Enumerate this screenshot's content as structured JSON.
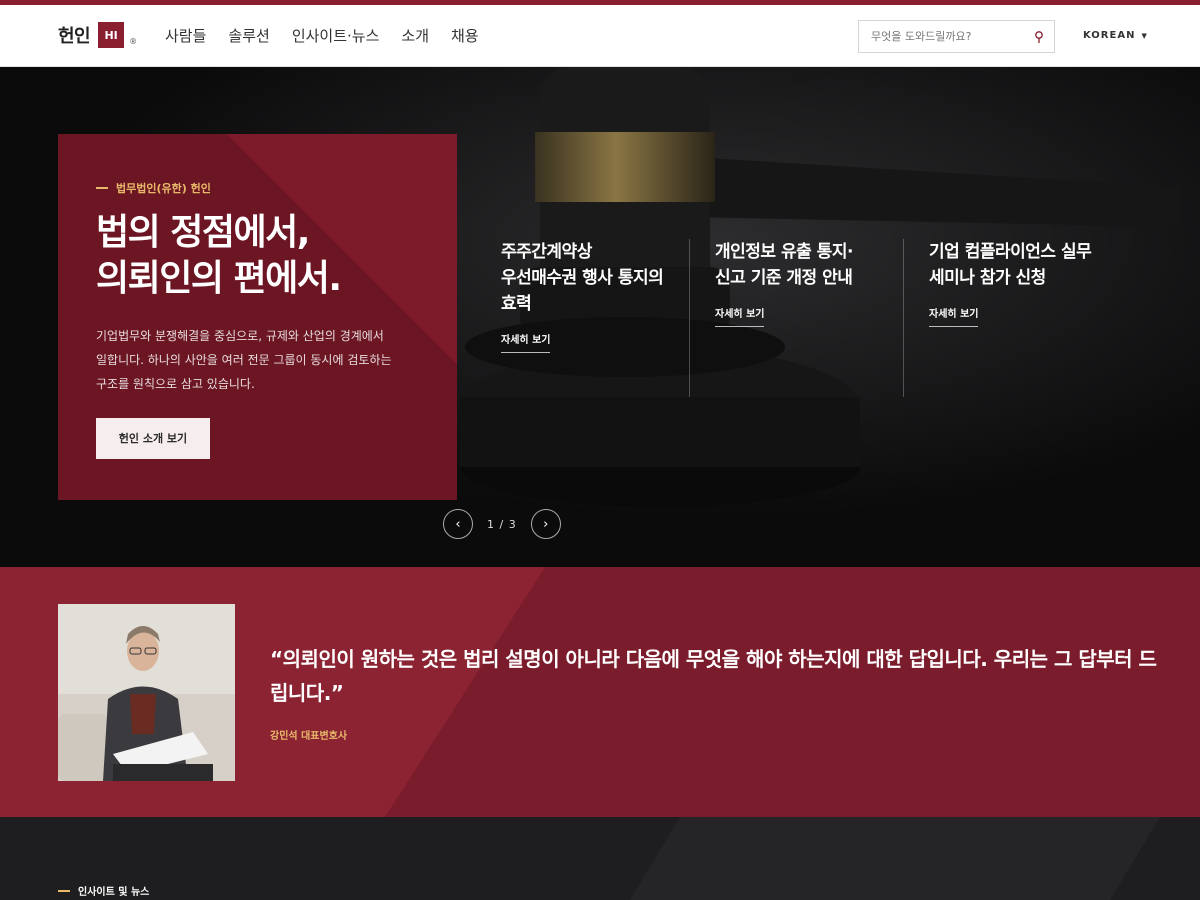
{
  "header": {
    "logo_text": "헌인",
    "logo_badge": "HI",
    "logo_reg": "®",
    "nav": [
      "사람들",
      "솔루션",
      "인사이트·뉴스",
      "소개",
      "채용"
    ],
    "search_placeholder": "무엇을 도와드릴까요?",
    "language": "KOREAN"
  },
  "hero": {
    "eyebrow": "법무법인(유한) 헌인",
    "title": "법의 정점에서,\n의뢰인의 편에서.",
    "description": "기업법무와 분쟁해결을 중심으로, 규제와 산업의 경계에서\n일합니다. 하나의 사안을 여러 전문 그룹이 동시에 검토하는\n구조를 원칙으로 삼고 있습니다.",
    "button": "헌인 소개 보기",
    "news": [
      {
        "title": "주주간계약상\n우선매수권 행사 통지의\n효력",
        "more": "자세히 보기"
      },
      {
        "title": "개인정보 유출 통지·\n신고 기준 개정 안내",
        "more": "자세히 보기"
      },
      {
        "title": "기업 컴플라이언스 실무\n세미나 참가 신청",
        "more": "자세히 보기"
      }
    ],
    "pager": {
      "prev": "‹",
      "count": "1 / 3",
      "next": "›"
    }
  },
  "quote": {
    "text": "“의뢰인이 원하는 것은 법리 설명이 아니라 다음에 무엇을 해야 하는지에 대한 답입니다. 우리는 그 답부터 드립니다.”",
    "author": "강민석 대표변호사"
  },
  "section": {
    "eyebrow": "인사이트 및 뉴스"
  },
  "colors": {
    "brand": "#8a1f30",
    "accent": "#e9b96a"
  },
  "icons": {
    "search": "search-icon",
    "caret": "caret-down-icon"
  }
}
